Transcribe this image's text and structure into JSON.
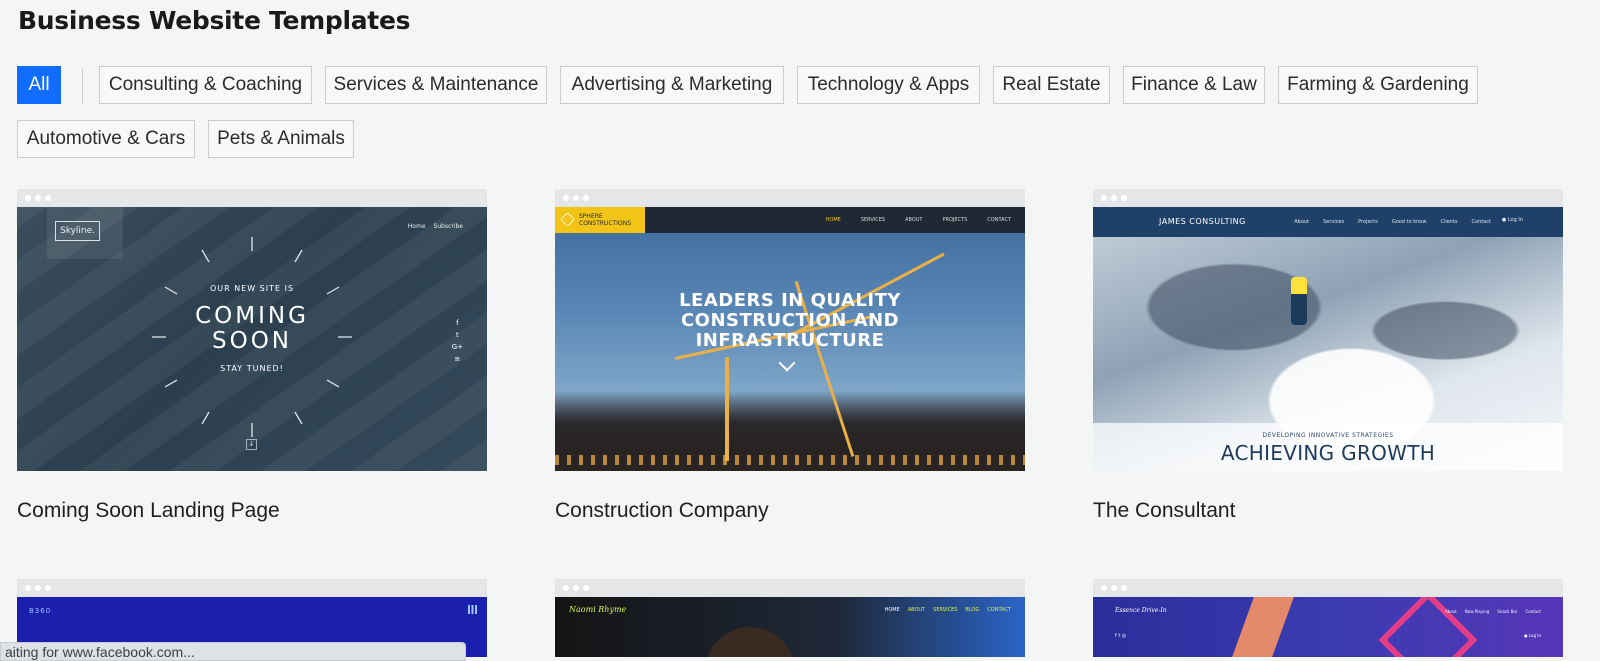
{
  "page": {
    "title": "Business Website Templates"
  },
  "filters": [
    {
      "label": "All",
      "active": true
    },
    {
      "label": "Consulting & Coaching"
    },
    {
      "label": "Services & Maintenance"
    },
    {
      "label": "Advertising & Marketing"
    },
    {
      "label": "Technology & Apps"
    },
    {
      "label": "Real Estate"
    },
    {
      "label": "Finance & Law"
    },
    {
      "label": "Farming & Gardening"
    },
    {
      "label": "Automotive & Cars"
    },
    {
      "label": "Pets & Animals"
    }
  ],
  "templates": [
    {
      "name": "Coming Soon Landing Page",
      "preview": {
        "logo": "Skyline.",
        "nav": [
          "Home",
          "Subscribe"
        ],
        "kicker": "OUR NEW SITE IS",
        "headline_1": "COMING",
        "headline_2": "SOON",
        "subline": "STAY TUNED!",
        "social": [
          "f",
          "t",
          "G+",
          "≡"
        ]
      }
    },
    {
      "name": "Construction Company",
      "preview": {
        "brand_1": "SPHERE",
        "brand_2": "CONSTRUCTIONS",
        "nav": [
          "HOME",
          "SERVICES",
          "ABOUT",
          "PROJECTS",
          "CONTACT"
        ],
        "headline_1": "LEADERS IN QUALITY",
        "headline_2": "CONSTRUCTION AND",
        "headline_3": "INFRASTRUCTURE"
      }
    },
    {
      "name": "The Consultant",
      "preview": {
        "brand_1": "JAMES",
        "brand_2": "CONSULTING",
        "nav": [
          "About",
          "Services",
          "Projects",
          "Good to know",
          "Clients",
          "Contact"
        ],
        "login": "Log In",
        "kicker": "DEVELOPING INNOVATIVE STRATEGIES",
        "headline": "ACHIEVING GROWTH"
      }
    },
    {
      "preview": {
        "brand": "B360"
      }
    },
    {
      "preview": {
        "brand": "Naomi Rhyme",
        "nav": [
          "HOME",
          "ABOUT",
          "SERVICES",
          "BLOG",
          "CONTACT"
        ]
      }
    },
    {
      "preview": {
        "brand": "Essence Drive-In",
        "nav": [
          "About",
          "Now Playing",
          "Snack Bar",
          "Contact"
        ],
        "social": "f  t  ◎",
        "login": "Log In"
      }
    }
  ],
  "browser": {
    "status_text": "aiting for www.facebook.com..."
  },
  "colors": {
    "accent": "#116dff",
    "background": "#f4f5f5"
  }
}
